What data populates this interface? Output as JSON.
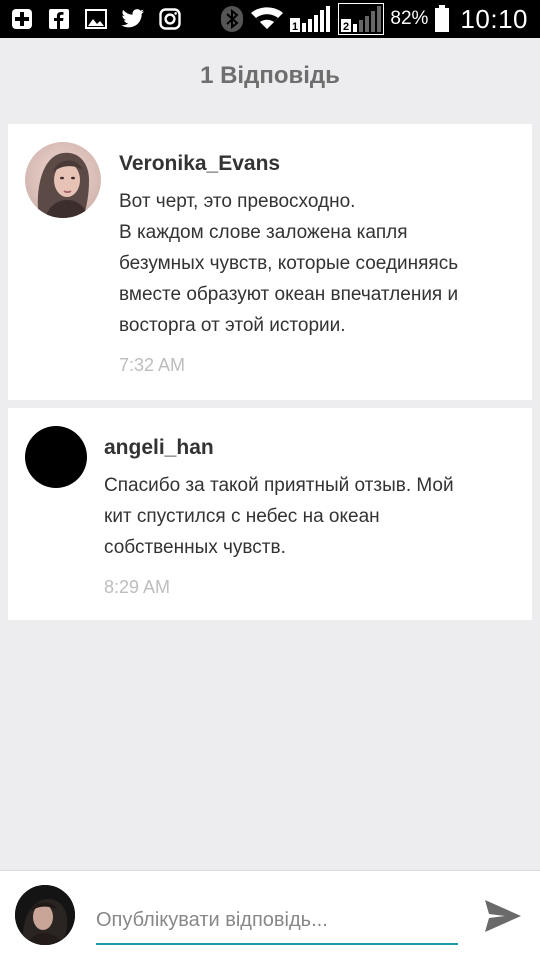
{
  "status_bar": {
    "battery_percent": "82%",
    "time": "10:10",
    "icons": [
      "plus-icon",
      "facebook-icon",
      "image-icon",
      "twitter-icon",
      "instagram-icon",
      "bluetooth-icon",
      "wifi-icon",
      "signal-sim1-icon",
      "signal-sim2-icon",
      "battery-icon"
    ]
  },
  "thread": {
    "title": "1 Відповідь"
  },
  "comments": [
    {
      "author": "Veronika_Evans",
      "text_lines": [
        "Вот черт, это превосходно.",
        "В каждом слове заложена капля",
        "безумных чувств, которые соединяясь",
        "вместе образуют океан впечатления и",
        "восторга от этой истории."
      ],
      "time": "7:32 AM"
    },
    {
      "author": "angeli_han",
      "text_lines": [
        "Спасибо за такой приятный отзыв. Мой",
        "кит спустился с небес на океан",
        "собственных чувств."
      ],
      "time": "8:29 AM"
    }
  ],
  "reply": {
    "placeholder": "Опублікувати відповідь...",
    "accent_color": "#1e9aa8"
  }
}
